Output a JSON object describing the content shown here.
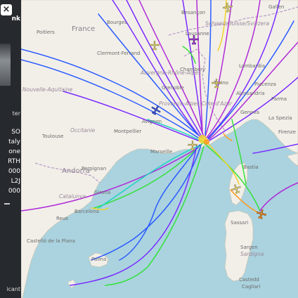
{
  "sidebar": {
    "close_glyph": "×",
    "link_text": "nk",
    "flight_rows": [
      "SO",
      "taly",
      "one",
      "RTH",
      "000",
      "L2J",
      "000"
    ],
    "bottom_label": "ter",
    "extra_label": "icant"
  },
  "map": {
    "countries": [
      "France",
      "Andorra"
    ],
    "places": [
      "Poitiers",
      "Bourges",
      "Besançon",
      "Lausanne",
      "Clermont-Ferrand",
      "Grenoble",
      "Chambéry",
      "Torino",
      "Alessandria",
      "Piacenza",
      "Parma",
      "Genova",
      "La Spezia",
      "Firenze",
      "Toulouse",
      "Montpellier",
      "Avignon",
      "Marseille",
      "Perpignan",
      "Girona",
      "Barcelona",
      "Reus",
      "Castelló de la Plana",
      "Palma",
      "Sassari",
      "Castedd",
      "Cagliari",
      "Bastia",
      "Sargen",
      "Gallen",
      "Lombardia"
    ],
    "regions": [
      "Nouvelle-Aquitaine",
      "Occitanie",
      "Auvergne-Rhône-Alpes",
      "Provence-Alpes-Côte d'Azur",
      "Schweiz/Suisse/Svizzera",
      "Catalunya",
      "Sardigna"
    ],
    "colors": {
      "land": "#f2efe9",
      "sea": "#aad3df",
      "track_purple": "#7a2bff",
      "track_violet": "#b02bd8",
      "track_blue": "#2b5bff",
      "track_green": "#35e03a",
      "track_yellow": "#f0d22a",
      "track_orange": "#ff9a1a",
      "track_teal": "#20d4c0",
      "aircraft_yellow": "#f2e16a",
      "aircraft_blue": "#3d58d8",
      "aircraft_orange": "#f08a1f",
      "aircraft_purple": "#a53ad8"
    },
    "aircraft_icons": [
      "plane-icon",
      "plane-icon",
      "plane-icon",
      "plane-icon",
      "plane-icon",
      "plane-icon",
      "plane-icon",
      "plane-icon"
    ]
  }
}
